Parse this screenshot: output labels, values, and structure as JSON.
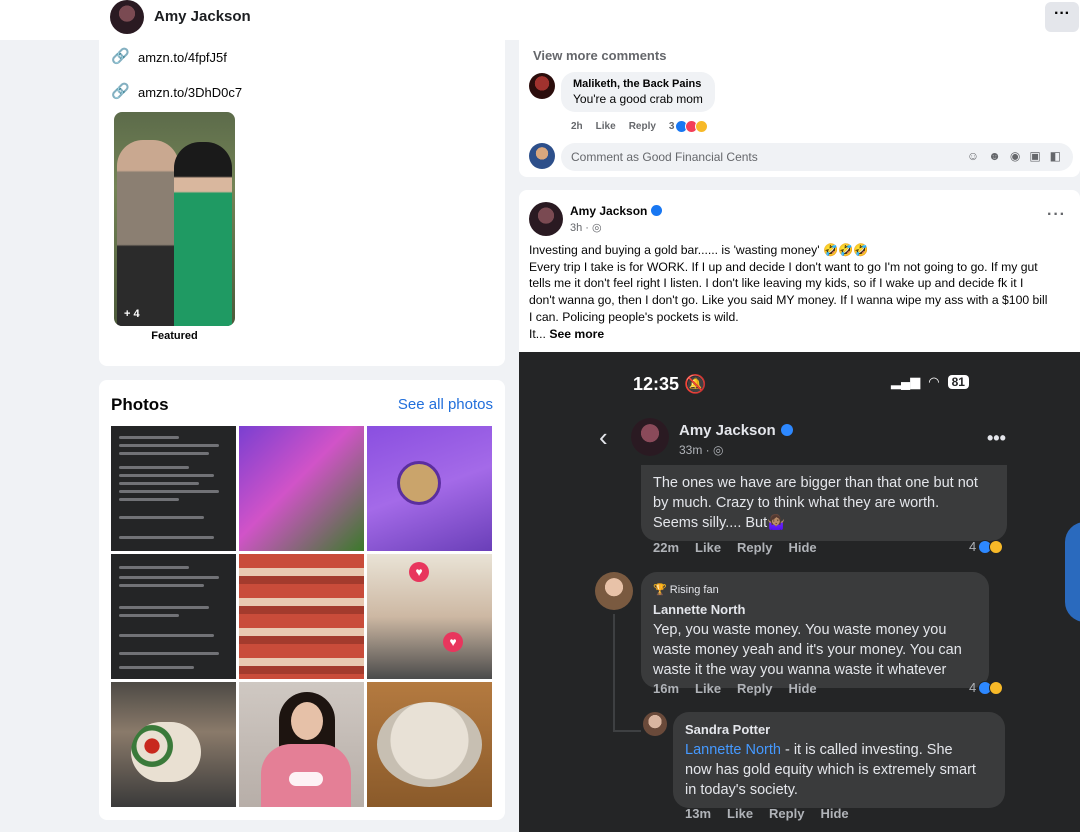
{
  "topbar": {
    "profile_name": "Amy Jackson",
    "more_label": "···"
  },
  "intro": {
    "links": [
      "amzn.to/4fpfJ5f",
      "amzn.to/3DhD0c7"
    ],
    "featured": {
      "count": "+ 4",
      "label": "Featured"
    }
  },
  "photos": {
    "title": "Photos",
    "see_all": "See all photos"
  },
  "comments": {
    "view_more": "View more comments",
    "items": [
      {
        "author": "Maliketh, the Back Pains",
        "text": "You're a good crab mom",
        "time": "2h",
        "like": "Like",
        "reply": "Reply",
        "reactions": "3"
      }
    ],
    "input_placeholder": "Comment as Good Financial Cents"
  },
  "post": {
    "author": "Amy Jackson",
    "time": "3h",
    "more": "···",
    "lines": [
      "Investing and buying a gold bar...... is 'wasting money' 🤣🤣🤣",
      "Every trip I take is for WORK. If I up and decide I don't want to go I'm not going to go. If my gut",
      "tells me it don't feel right I listen. I don't like leaving my kids, so if I wake up and decide fk it I",
      "don't wanna go, then I don't go. Like you said MY money. If I wanna wipe my ass with a $100 bill",
      "I can. Policing people's pockets is wild."
    ],
    "tail": "It... ",
    "see_more": "See more"
  },
  "screenshot": {
    "clock": "12:35",
    "battery": "81",
    "author": "Amy Jackson",
    "time": "33m · ",
    "more": "•••",
    "comment1": {
      "lines": [
        "The ones we have are bigger than that one but not",
        "by much. Crazy to think what they are worth.",
        "Seems silly.... But🤷🏽‍♀️"
      ],
      "time": "22m",
      "like": "Like",
      "reply": "Reply",
      "hide": "Hide",
      "reactions": "4"
    },
    "comment2": {
      "badge": "Rising fan",
      "author": "Lannette North",
      "lines": [
        "Yep, you waste money. You waste money you",
        "waste money yeah and it's your money. You can",
        "waste it the way you wanna waste it whatever"
      ],
      "time": "16m",
      "like": "Like",
      "reply": "Reply",
      "hide": "Hide",
      "reactions": "4"
    },
    "comment3": {
      "author": "Sandra Potter",
      "mention": "Lannette North",
      "line1_rest": " - it is called investing. She",
      "lines": [
        "now has gold equity which is extremely smart",
        "in today's society."
      ],
      "time": "13m",
      "like": "Like",
      "reply": "Reply",
      "hide": "Hide"
    }
  },
  "colors": {
    "link_blue": "#216fdb",
    "verified_blue": "#1877f2",
    "dark_bg": "#242526",
    "bubble_dark": "#3a3b3c"
  }
}
